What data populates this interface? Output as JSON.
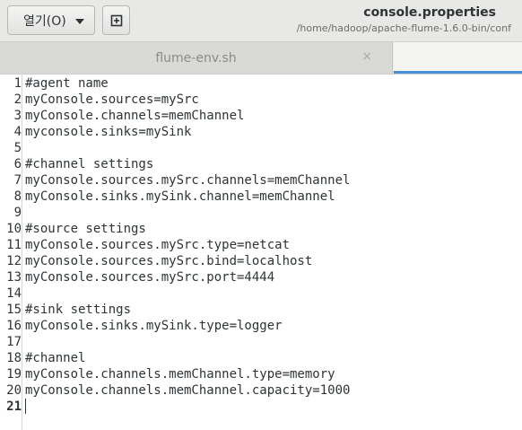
{
  "header": {
    "open_label": "열기(O)",
    "title": "console.properties",
    "subtitle": "/home/hadoop/apache-flume-1.6.0-bin/conf"
  },
  "tabs": [
    {
      "label": "flume-env.sh",
      "close": "×"
    },
    {
      "label": ""
    }
  ],
  "editor": {
    "lines": [
      "#agent name",
      "myConsole.sources=mySrc",
      "myConsole.channels=memChannel",
      "myconsole.sinks=mySink",
      "",
      "#channel settings",
      "myConsole.sources.mySrc.channels=memChannel",
      "myConsole.sinks.mySink.channel=memChannel",
      "",
      "#source settings",
      "myConsole.sources.mySrc.type=netcat",
      "myConsole.sources.mySrc.bind=localhost",
      "myConsole.sources.mySrc.port=4444",
      "",
      "#sink settings",
      "myConsole.sinks.mySink.type=logger",
      "",
      "#channel",
      "myConsole.channels.memChannel.type=memory",
      "myConsole.channels.memChannel.capacity=1000",
      ""
    ],
    "numbers": [
      "1",
      "2",
      "3",
      "4",
      "5",
      "6",
      "7",
      "8",
      "9",
      "10",
      "11",
      "12",
      "13",
      "14",
      "15",
      "16",
      "17",
      "18",
      "19",
      "20",
      "21"
    ],
    "current_line": 21
  }
}
